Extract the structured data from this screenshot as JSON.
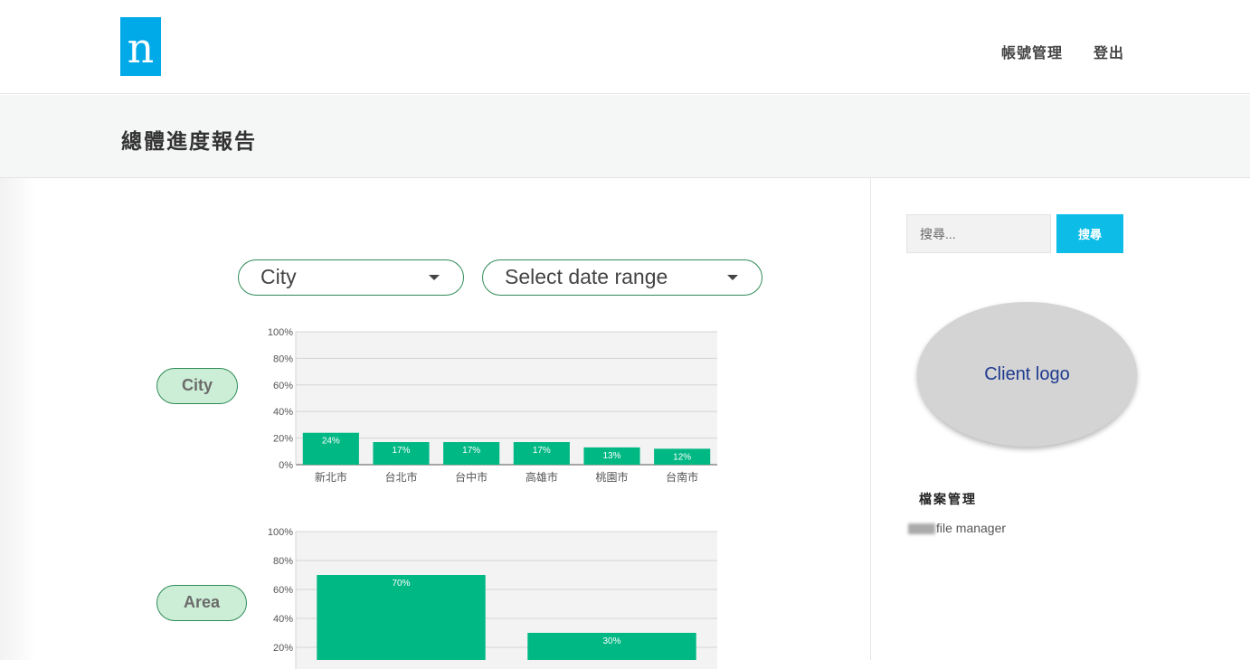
{
  "header": {
    "logo_text": "n",
    "brand_color": "#00a9e8",
    "nav": {
      "account": "帳號管理",
      "logout": "登出"
    }
  },
  "page": {
    "title": "總體進度報告"
  },
  "filters": {
    "city": {
      "value": "City"
    },
    "date_range": {
      "value": "Select date range"
    }
  },
  "charts": {
    "city": {
      "label": "City"
    },
    "area": {
      "label": "Area"
    }
  },
  "chart_data": [
    {
      "type": "bar",
      "categories": [
        "新北市",
        "台北市",
        "台中市",
        "高雄市",
        "桃園市",
        "台南市"
      ],
      "values": [
        24,
        17,
        17,
        17,
        13,
        12
      ],
      "value_labels": [
        "24%",
        "17%",
        "17%",
        "17%",
        "13%",
        "12%"
      ],
      "yticks": [
        "0%",
        "20%",
        "40%",
        "60%",
        "80%",
        "100%"
      ],
      "ylim": [
        0,
        100
      ],
      "bar_color": "#00b884",
      "grid": true
    },
    {
      "type": "bar",
      "categories": [
        "",
        ""
      ],
      "values": [
        70,
        30
      ],
      "value_labels": [
        "70%",
        "30%"
      ],
      "yticks": [
        "20%",
        "40%",
        "60%",
        "80%",
        "100%"
      ],
      "ylim": [
        0,
        100
      ],
      "bar_color": "#00b884",
      "grid": true
    }
  ],
  "sidebar": {
    "search_placeholder": "搜尋...",
    "search_button": "搜尋",
    "client_logo": "Client logo",
    "file_section_title": "檔案管理",
    "file_link": "file manager",
    "accent_color": "#0dbde8"
  }
}
